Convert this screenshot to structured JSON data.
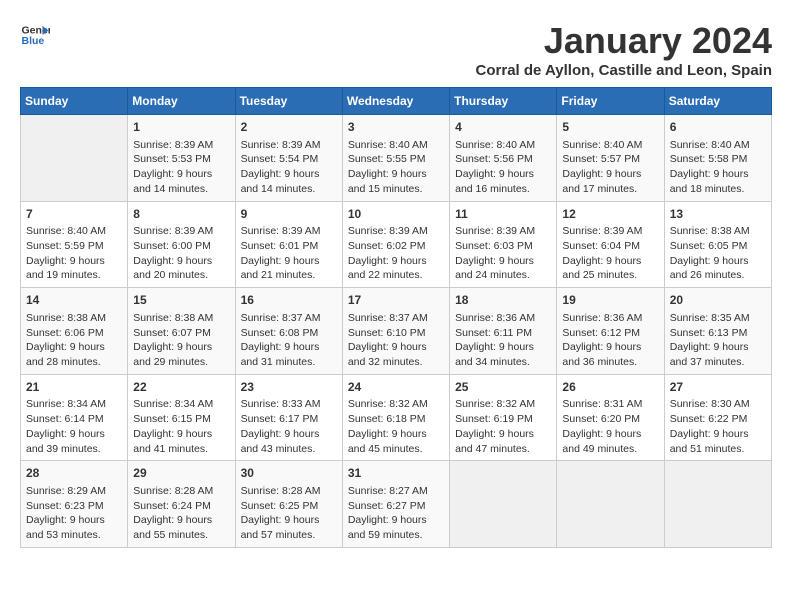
{
  "header": {
    "logo_line1": "General",
    "logo_line2": "Blue",
    "month": "January 2024",
    "location": "Corral de Ayllon, Castille and Leon, Spain"
  },
  "days_of_week": [
    "Sunday",
    "Monday",
    "Tuesday",
    "Wednesday",
    "Thursday",
    "Friday",
    "Saturday"
  ],
  "weeks": [
    [
      {
        "day": "",
        "data": ""
      },
      {
        "day": "1",
        "data": "Sunrise: 8:39 AM\nSunset: 5:53 PM\nDaylight: 9 hours\nand 14 minutes."
      },
      {
        "day": "2",
        "data": "Sunrise: 8:39 AM\nSunset: 5:54 PM\nDaylight: 9 hours\nand 14 minutes."
      },
      {
        "day": "3",
        "data": "Sunrise: 8:40 AM\nSunset: 5:55 PM\nDaylight: 9 hours\nand 15 minutes."
      },
      {
        "day": "4",
        "data": "Sunrise: 8:40 AM\nSunset: 5:56 PM\nDaylight: 9 hours\nand 16 minutes."
      },
      {
        "day": "5",
        "data": "Sunrise: 8:40 AM\nSunset: 5:57 PM\nDaylight: 9 hours\nand 17 minutes."
      },
      {
        "day": "6",
        "data": "Sunrise: 8:40 AM\nSunset: 5:58 PM\nDaylight: 9 hours\nand 18 minutes."
      }
    ],
    [
      {
        "day": "7",
        "data": "Sunrise: 8:40 AM\nSunset: 5:59 PM\nDaylight: 9 hours\nand 19 minutes."
      },
      {
        "day": "8",
        "data": "Sunrise: 8:39 AM\nSunset: 6:00 PM\nDaylight: 9 hours\nand 20 minutes."
      },
      {
        "day": "9",
        "data": "Sunrise: 8:39 AM\nSunset: 6:01 PM\nDaylight: 9 hours\nand 21 minutes."
      },
      {
        "day": "10",
        "data": "Sunrise: 8:39 AM\nSunset: 6:02 PM\nDaylight: 9 hours\nand 22 minutes."
      },
      {
        "day": "11",
        "data": "Sunrise: 8:39 AM\nSunset: 6:03 PM\nDaylight: 9 hours\nand 24 minutes."
      },
      {
        "day": "12",
        "data": "Sunrise: 8:39 AM\nSunset: 6:04 PM\nDaylight: 9 hours\nand 25 minutes."
      },
      {
        "day": "13",
        "data": "Sunrise: 8:38 AM\nSunset: 6:05 PM\nDaylight: 9 hours\nand 26 minutes."
      }
    ],
    [
      {
        "day": "14",
        "data": "Sunrise: 8:38 AM\nSunset: 6:06 PM\nDaylight: 9 hours\nand 28 minutes."
      },
      {
        "day": "15",
        "data": "Sunrise: 8:38 AM\nSunset: 6:07 PM\nDaylight: 9 hours\nand 29 minutes."
      },
      {
        "day": "16",
        "data": "Sunrise: 8:37 AM\nSunset: 6:08 PM\nDaylight: 9 hours\nand 31 minutes."
      },
      {
        "day": "17",
        "data": "Sunrise: 8:37 AM\nSunset: 6:10 PM\nDaylight: 9 hours\nand 32 minutes."
      },
      {
        "day": "18",
        "data": "Sunrise: 8:36 AM\nSunset: 6:11 PM\nDaylight: 9 hours\nand 34 minutes."
      },
      {
        "day": "19",
        "data": "Sunrise: 8:36 AM\nSunset: 6:12 PM\nDaylight: 9 hours\nand 36 minutes."
      },
      {
        "day": "20",
        "data": "Sunrise: 8:35 AM\nSunset: 6:13 PM\nDaylight: 9 hours\nand 37 minutes."
      }
    ],
    [
      {
        "day": "21",
        "data": "Sunrise: 8:34 AM\nSunset: 6:14 PM\nDaylight: 9 hours\nand 39 minutes."
      },
      {
        "day": "22",
        "data": "Sunrise: 8:34 AM\nSunset: 6:15 PM\nDaylight: 9 hours\nand 41 minutes."
      },
      {
        "day": "23",
        "data": "Sunrise: 8:33 AM\nSunset: 6:17 PM\nDaylight: 9 hours\nand 43 minutes."
      },
      {
        "day": "24",
        "data": "Sunrise: 8:32 AM\nSunset: 6:18 PM\nDaylight: 9 hours\nand 45 minutes."
      },
      {
        "day": "25",
        "data": "Sunrise: 8:32 AM\nSunset: 6:19 PM\nDaylight: 9 hours\nand 47 minutes."
      },
      {
        "day": "26",
        "data": "Sunrise: 8:31 AM\nSunset: 6:20 PM\nDaylight: 9 hours\nand 49 minutes."
      },
      {
        "day": "27",
        "data": "Sunrise: 8:30 AM\nSunset: 6:22 PM\nDaylight: 9 hours\nand 51 minutes."
      }
    ],
    [
      {
        "day": "28",
        "data": "Sunrise: 8:29 AM\nSunset: 6:23 PM\nDaylight: 9 hours\nand 53 minutes."
      },
      {
        "day": "29",
        "data": "Sunrise: 8:28 AM\nSunset: 6:24 PM\nDaylight: 9 hours\nand 55 minutes."
      },
      {
        "day": "30",
        "data": "Sunrise: 8:28 AM\nSunset: 6:25 PM\nDaylight: 9 hours\nand 57 minutes."
      },
      {
        "day": "31",
        "data": "Sunrise: 8:27 AM\nSunset: 6:27 PM\nDaylight: 9 hours\nand 59 minutes."
      },
      {
        "day": "",
        "data": ""
      },
      {
        "day": "",
        "data": ""
      },
      {
        "day": "",
        "data": ""
      }
    ]
  ]
}
